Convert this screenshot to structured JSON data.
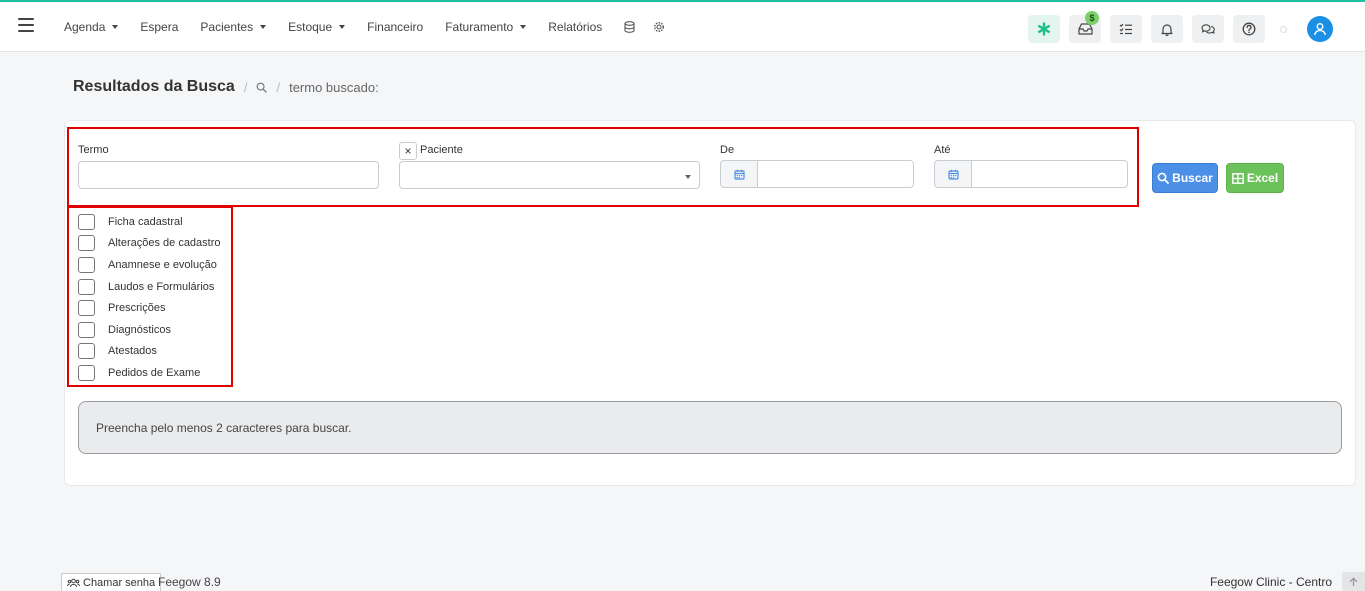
{
  "nav": {
    "items": [
      {
        "label": "Agenda",
        "dropdown": true
      },
      {
        "label": "Espera",
        "dropdown": false
      },
      {
        "label": "Pacientes",
        "dropdown": true
      },
      {
        "label": "Estoque",
        "dropdown": true
      },
      {
        "label": "Financeiro",
        "dropdown": false
      },
      {
        "label": "Faturamento",
        "dropdown": true
      },
      {
        "label": "Relatórios",
        "dropdown": false
      }
    ],
    "icons": [
      "database-icon",
      "gear-icon"
    ],
    "actions": [
      "asterisk-icon",
      "inbox-icon",
      "task-list-icon",
      "bell-icon",
      "chat-icon",
      "help-icon"
    ],
    "inbox_badge": "$",
    "accent_color": "#1fbfa2"
  },
  "header": {
    "title": "Resultados da Busca",
    "breadcrumb_sep": "/",
    "search_label": "termo buscado:"
  },
  "form": {
    "termo_label": "Termo",
    "termo_value": "",
    "paciente_clear": "×",
    "paciente_label": "Paciente",
    "paciente_value": "",
    "de_label": "De",
    "de_value": "",
    "ate_label": "Até",
    "ate_value": "",
    "buscar_label": "Buscar",
    "excel_label": "Excel"
  },
  "checks": [
    {
      "label": "Ficha cadastral",
      "checked": false
    },
    {
      "label": "Alterações de cadastro",
      "checked": false
    },
    {
      "label": "Anamnese e evolução",
      "checked": false
    },
    {
      "label": "Laudos e Formulários",
      "checked": false
    },
    {
      "label": "Prescrições",
      "checked": false
    },
    {
      "label": "Diagnósticos",
      "checked": false
    },
    {
      "label": "Atestados",
      "checked": false
    },
    {
      "label": "Pedidos de Exame",
      "checked": false
    }
  ],
  "alert": {
    "message": "Preencha pelo menos 2 caracteres para buscar."
  },
  "footer": {
    "chamar_label": "Chamar senha",
    "version": "Feegow 8.9",
    "clinic": "Feegow Clinic - Centro"
  }
}
